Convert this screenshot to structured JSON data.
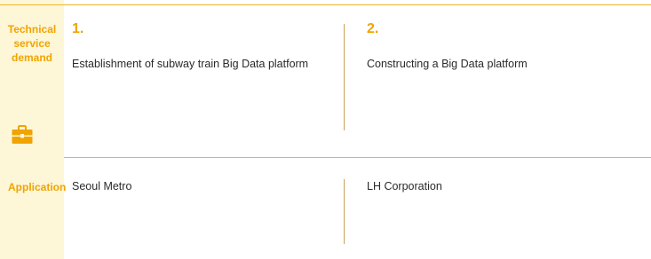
{
  "labels": {
    "technical": [
      "Technical",
      "service",
      "demand"
    ],
    "application": "Application"
  },
  "items": [
    {
      "number": "1.",
      "description": "Establishment of subway train Big Data platform",
      "application": "Seoul Metro"
    },
    {
      "number": "2.",
      "description": "Constructing a Big Data platform",
      "application": "LH Corporation"
    }
  ],
  "icon": "briefcase-icon",
  "colors": {
    "accent": "#f0a400",
    "side_background": "#fdf6d7",
    "rule": "#f0b429",
    "text": "#2a2a2a"
  }
}
